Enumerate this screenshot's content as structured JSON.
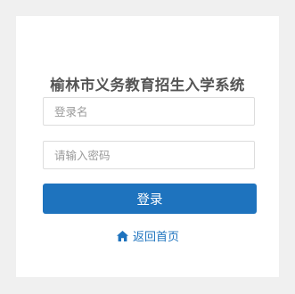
{
  "login": {
    "title": "榆林市义务教育招生入学系统",
    "username_placeholder": "登录名",
    "username_value": "",
    "password_placeholder": "请输入密码",
    "password_value": "",
    "login_button_label": "登录",
    "back_home_label": "返回首页",
    "home_icon": "home-icon"
  },
  "colors": {
    "page_background": "#f0f0f0",
    "card_background": "#ffffff",
    "primary": "#1e73be",
    "title_text": "#555555",
    "placeholder_text": "#9a9a9a",
    "input_border": "#dddddd"
  }
}
